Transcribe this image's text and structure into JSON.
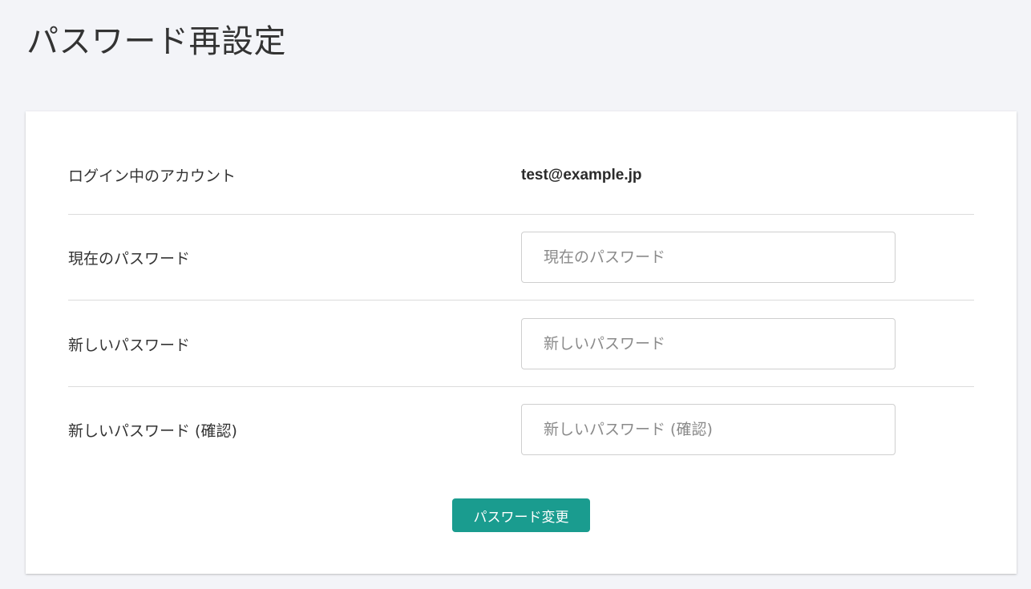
{
  "page": {
    "title": "パスワード再設定"
  },
  "form": {
    "account": {
      "label": "ログイン中のアカウント",
      "value": "test@example.jp"
    },
    "current_password": {
      "label": "現在のパスワード",
      "placeholder": "現在のパスワード",
      "value": ""
    },
    "new_password": {
      "label": "新しいパスワード",
      "placeholder": "新しいパスワード",
      "value": ""
    },
    "confirm_password": {
      "label": "新しいパスワード (確認)",
      "placeholder": "新しいパスワード (確認)",
      "value": ""
    },
    "submit_label": "パスワード変更"
  },
  "colors": {
    "background": "#f3f4f8",
    "card": "#ffffff",
    "accent": "#1a9c8f",
    "divider": "#dcdcdc"
  }
}
